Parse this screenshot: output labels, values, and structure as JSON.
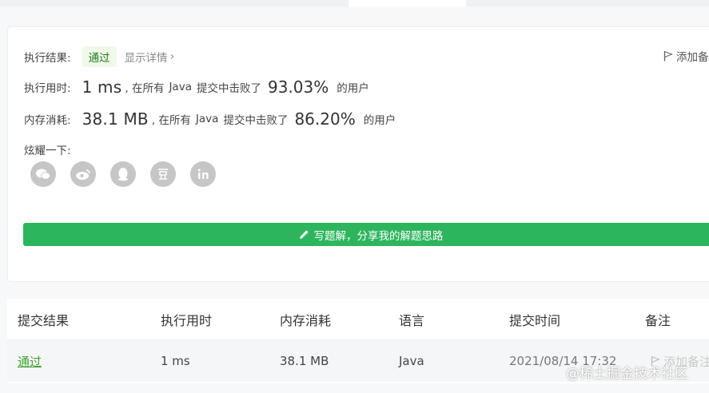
{
  "result": {
    "status_label": "执行结果:",
    "status_value": "通过",
    "details_link": "显示详情",
    "add_note": "添加备注",
    "runtime": {
      "label": "执行用时:",
      "value": "1 ms",
      "prefix": ", 在所有",
      "language": "Java",
      "suffix": "提交中击败了",
      "percent": "93.03%",
      "users": "的用户"
    },
    "memory": {
      "label": "内存消耗:",
      "value": "38.1 MB",
      "prefix": ", 在所有",
      "language": "Java",
      "suffix": "提交中击败了",
      "percent": "86.20%",
      "users": "的用户"
    },
    "share_label": "炫耀一下:",
    "share_icons": [
      "wechat-icon",
      "weibo-icon",
      "qq-icon",
      "douban-icon",
      "linkedin-icon"
    ],
    "write_solution": "写题解，分享我的解题思路"
  },
  "submissions": {
    "headers": [
      "提交结果",
      "执行用时",
      "内存消耗",
      "语言",
      "提交时间",
      "备注"
    ],
    "rows": [
      {
        "status": "通过",
        "runtime": "1 ms",
        "memory": "38.1 MB",
        "language": "Java",
        "time": "2021/08/14 17:32",
        "note": "添加备注"
      }
    ]
  },
  "watermark": "@稀土掘金技术社区",
  "colors": {
    "accent_green": "#2db55d",
    "status_green": "#3fa12f",
    "icon_gray": "#c6c6c6"
  }
}
